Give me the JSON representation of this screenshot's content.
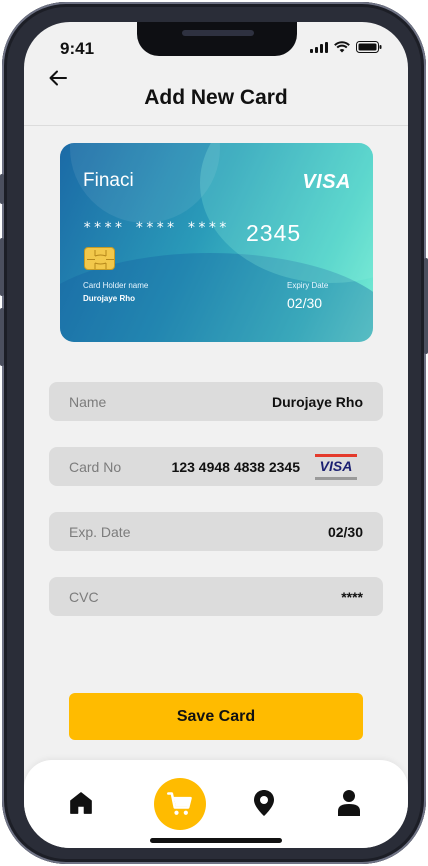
{
  "status_bar": {
    "time": "9:41"
  },
  "header": {
    "title": "Add New Card"
  },
  "card": {
    "brand": "Finaci",
    "network": "VISA",
    "masked_number": "**** **** ****",
    "last4": "2345",
    "holder_label": "Card Holder name",
    "holder_name": "Durojaye Rho",
    "expiry_label": "Expiry Date",
    "expiry_value": "02/30"
  },
  "form": {
    "name": {
      "label": "Name",
      "value": "Durojaye Rho"
    },
    "card_no": {
      "label": "Card No",
      "value": "123 4948 4838 2345",
      "network": "VISA"
    },
    "exp_date": {
      "label": "Exp. Date",
      "value": "02/30"
    },
    "cvc": {
      "label": "CVC",
      "value": "****"
    }
  },
  "save_button": {
    "label": "Save Card"
  },
  "bottom_nav": {
    "items": [
      {
        "icon": "home-icon"
      },
      {
        "icon": "cart-icon",
        "active": true
      },
      {
        "icon": "location-pin-icon"
      },
      {
        "icon": "profile-icon"
      }
    ]
  },
  "colors": {
    "accent": "#ffbb00",
    "background": "#f1f1f1",
    "field": "#dcdcdc"
  }
}
